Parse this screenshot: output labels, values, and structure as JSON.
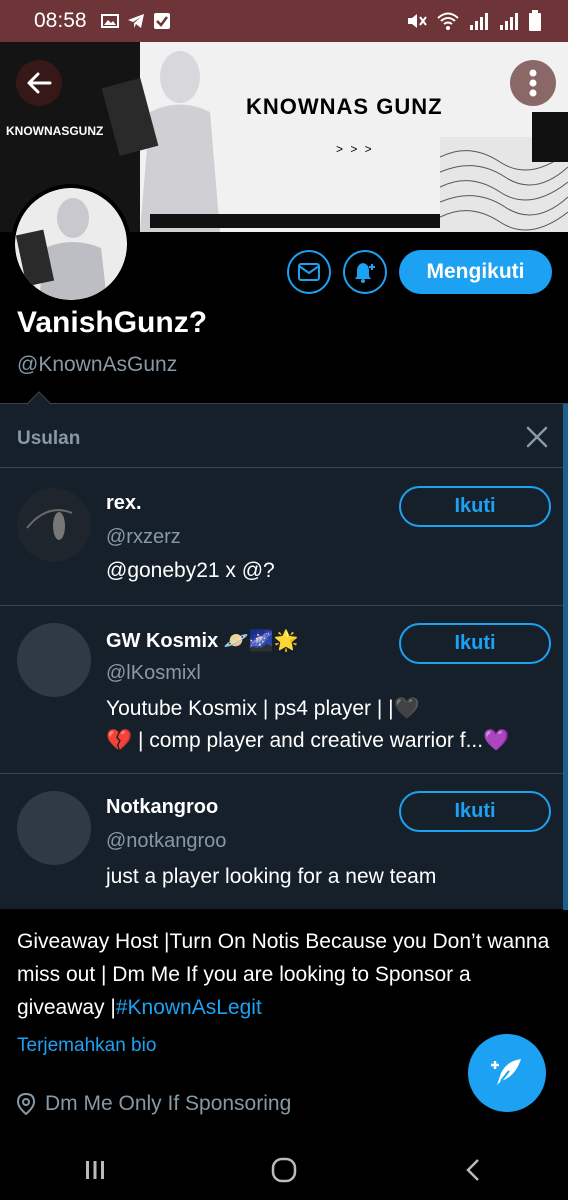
{
  "status_bar": {
    "time": "08:58"
  },
  "banner": {
    "title": "KNOWNAS GUNZ",
    "handle_text": "KNOWNASGUNZ",
    "arrows": "> > >"
  },
  "profile": {
    "display_name": "VanishGunz?",
    "username": "@KnownAsGunz",
    "follow_label": "Mengikuti"
  },
  "suggestions": {
    "heading": "Usulan",
    "items": [
      {
        "name": "rex.",
        "handle": "@rxzerz",
        "bio_line1": "@goneby21 x @?",
        "bio_line2": "",
        "button": "Ikuti"
      },
      {
        "name": "GW Kosmix 🪐🌌🌟",
        "handle": "@lKosmixl",
        "bio_line1": "Youtube Kosmix | ps4 player | |🖤",
        "bio_line2": "💔 | comp player and creative warrior f...💜",
        "button": "Ikuti"
      },
      {
        "name": "Notkangroo",
        "handle": "@notkangroo",
        "bio_line1": "just a player looking for a new team",
        "bio_line2": "",
        "button": "Ikuti"
      }
    ]
  },
  "bio": {
    "text": "Giveaway Host |Turn On Notis Because you Don’t wanna miss out | Dm Me If you are looking to Sponsor a giveaway |",
    "hashtag": "#KnownAsLegit",
    "translate_label": "Terjemahkan bio",
    "location": "Dm Me Only If Sponsoring"
  },
  "colors": {
    "accent": "#1da1f2",
    "status_bar": "#6d3538",
    "panel": "#15202b",
    "muted": "#8899a6"
  }
}
